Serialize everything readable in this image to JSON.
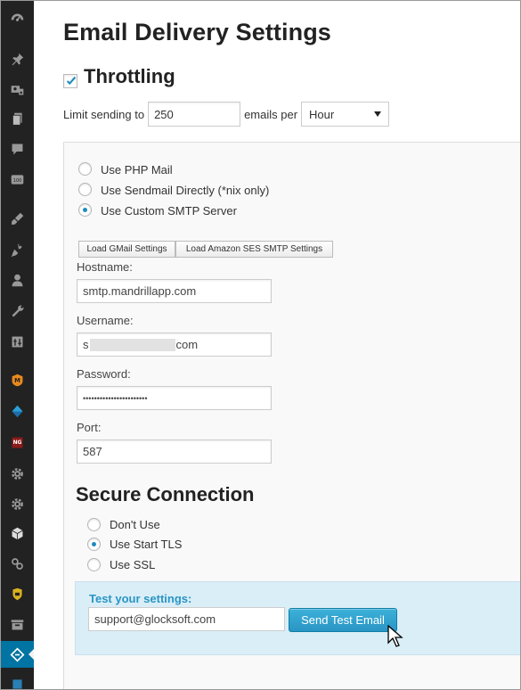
{
  "page": {
    "title": "Email Delivery Settings"
  },
  "sidebar": {
    "items": [
      {
        "icon": "dashboard-icon"
      },
      {
        "icon": "pin-icon"
      },
      {
        "icon": "media-icon"
      },
      {
        "icon": "pages-icon"
      },
      {
        "icon": "comments-icon"
      },
      {
        "icon": "feedback-icon"
      },
      {
        "icon": "appearance-icon"
      },
      {
        "icon": "plugins-icon"
      },
      {
        "icon": "users-icon"
      },
      {
        "icon": "tools-icon"
      },
      {
        "icon": "settings-icon"
      },
      {
        "icon": "plugin-logo-icon"
      },
      {
        "icon": "plugin-diamond-icon"
      },
      {
        "icon": "plugin-badge-icon"
      },
      {
        "icon": "gear-icon"
      },
      {
        "icon": "gear-icon"
      },
      {
        "icon": "cube-icon"
      },
      {
        "icon": "chain-icon"
      },
      {
        "icon": "plugin-shield-icon"
      },
      {
        "icon": "archive-icon"
      },
      {
        "icon": "email-settings-icon",
        "active": true
      },
      {
        "icon": "plugin-misc-icon"
      }
    ],
    "accent": "#0074a2"
  },
  "throttling": {
    "heading": "Throttling",
    "checked": true,
    "limit_label": "Limit sending to",
    "limit_value": "250",
    "per_label": "emails per",
    "period_value": "Hour"
  },
  "delivery": {
    "options": [
      {
        "label": "Use PHP Mail",
        "selected": false
      },
      {
        "label": "Use Sendmail Directly (*nix only)",
        "selected": false
      },
      {
        "label": "Use Custom SMTP Server",
        "selected": true
      }
    ],
    "preset_buttons": [
      "Load GMail Settings",
      "Load Amazon SES SMTP Settings"
    ]
  },
  "smtp": {
    "hostname_label": "Hostname:",
    "hostname_value": "smtp.mandrillapp.com",
    "username_label": "Username:",
    "username_prefix": "s",
    "username_suffix": "com",
    "password_label": "Password:",
    "password_value": "•••••••••••••••••••••••",
    "port_label": "Port:",
    "port_value": "587"
  },
  "secure": {
    "heading": "Secure Connection",
    "options": [
      {
        "label": "Don't Use",
        "selected": false
      },
      {
        "label": "Use Start TLS",
        "selected": true
      },
      {
        "label": "Use SSL",
        "selected": false
      }
    ]
  },
  "test": {
    "label": "Test your settings:",
    "email_value": "support@glocksoft.com",
    "button_label": "Send Test Email"
  },
  "colors": {
    "brand_blue": "#2a95c5",
    "test_bg": "#daeef7"
  }
}
